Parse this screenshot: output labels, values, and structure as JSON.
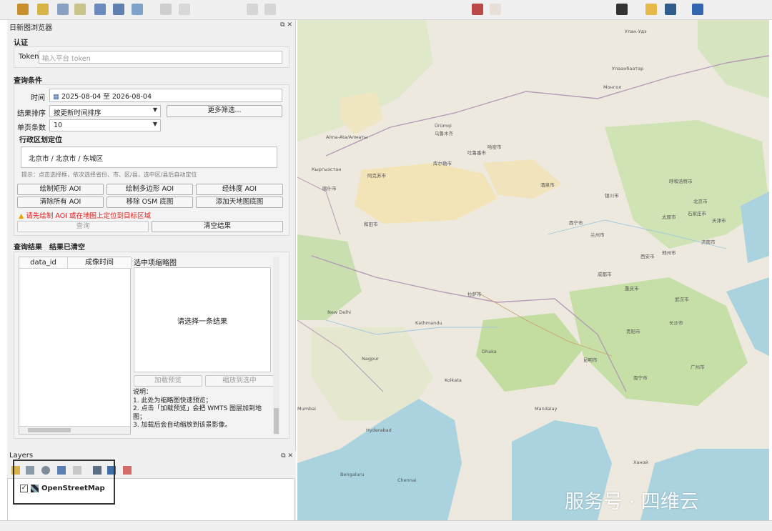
{
  "browser_panel": {
    "title": "日新图浏览器",
    "auth": {
      "section": "认证",
      "token_label": "Token",
      "token_placeholder": "输入平台 token"
    },
    "query": {
      "section": "查询条件",
      "time_label": "时间",
      "date_start": "2025-08-04",
      "date_sep": "至",
      "date_end": "2026-08-04",
      "sort_label": "结果排序",
      "sort_value": "按更新时间排序",
      "more_filters": "更多筛选...",
      "page_size_label": "单页条数",
      "page_size_value": "10",
      "region_label": "行政区划定位",
      "region_value": "北京市 / 北京市 / 东城区",
      "region_hint": "提示：点击选择框，依次选择省份、市、区/县，选中区/县后自动定位",
      "buttons": [
        "绘制矩形 AOI",
        "绘制多边形 AOI",
        "经纬度 AOI",
        "清除所有 AOI",
        "移除 OSM 底图",
        "添加天地图底图"
      ],
      "warning": "请先绘制 AOI 或在地图上定位到目标区域",
      "search_button": "查询",
      "clear_button": "清空结果"
    },
    "results": {
      "section": "查询结果",
      "status": "结果已清空",
      "columns": [
        "data_id",
        "成像时间"
      ],
      "thumb_title": "选中项缩略图",
      "thumb_placeholder": "请选择一条结果",
      "load_preview": "加载预览",
      "zoom_to": "缩放到选中",
      "notes": [
        "说明：",
        "1. 此处为缩略图快速预览；",
        "2. 点击「加载预览」会把 WMTS 图层加到地图；",
        "3. 加载后会自动缩放到该景影像。"
      ]
    }
  },
  "layers_panel": {
    "title": "Layers",
    "layer_name": "OpenStreetMap",
    "layer_checked": true
  },
  "map_labels": [
    "Alma-Ata/Алматы",
    "Кыргызстан",
    "Ürümqi",
    "乌鲁木齐",
    "吐鲁番市",
    "库尔勒市",
    "喀什市",
    "阿克苏市",
    "和田市",
    "哈密市",
    "酒泉市",
    "西宁市",
    "兰州市",
    "银川市",
    "呼和浩特市",
    "北京市",
    "天津市",
    "石家庄市",
    "太原市",
    "济南市",
    "郑州市",
    "西安市",
    "成都市",
    "重庆市",
    "武汉市",
    "长沙市",
    "贵阳市",
    "昆明市",
    "南宁市",
    "广州市",
    "拉萨市",
    "New Delhi",
    "Kathmandu",
    "Dhaka",
    "Kolkata",
    "Mumbai",
    "Bengaluru",
    "Hyderabad",
    "Улан-Удэ",
    "Улаанбаатар",
    "Монгол",
    "Ханой",
    "Mandalay",
    "Chennai",
    "Nagpur"
  ],
  "watermark": "服务号 · 四维云"
}
